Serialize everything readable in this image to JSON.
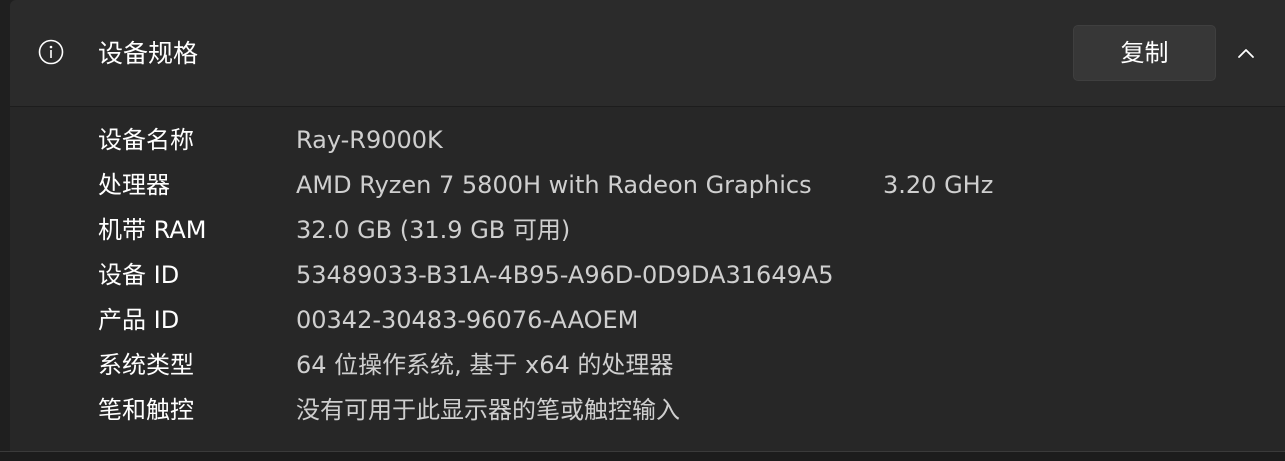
{
  "header": {
    "title": "设备规格",
    "copy_label": "复制",
    "icon": "info-icon",
    "toggle_icon": "chevron-up-icon"
  },
  "specs": [
    {
      "label": "设备名称",
      "value": "Ray-R9000K"
    },
    {
      "label": "处理器",
      "value": "AMD Ryzen 7 5800H with Radeon Graphics",
      "extra": "3.20 GHz"
    },
    {
      "label": "机带 RAM",
      "value": "32.0 GB (31.9 GB 可用)"
    },
    {
      "label": "设备 ID",
      "value": "53489033-B31A-4B95-A96D-0D9DA31649A5"
    },
    {
      "label": "产品 ID",
      "value": "00342-30483-96076-AAOEM"
    },
    {
      "label": "系统类型",
      "value": "64 位操作系统, 基于 x64 的处理器"
    },
    {
      "label": "笔和触控",
      "value": "没有可用于此显示器的笔或触控输入"
    }
  ],
  "colors": {
    "background": "#1f1f1f",
    "card": "#2b2b2b",
    "body": "#272727",
    "label_text": "#ffffff",
    "value_text": "#cfcfcf"
  }
}
